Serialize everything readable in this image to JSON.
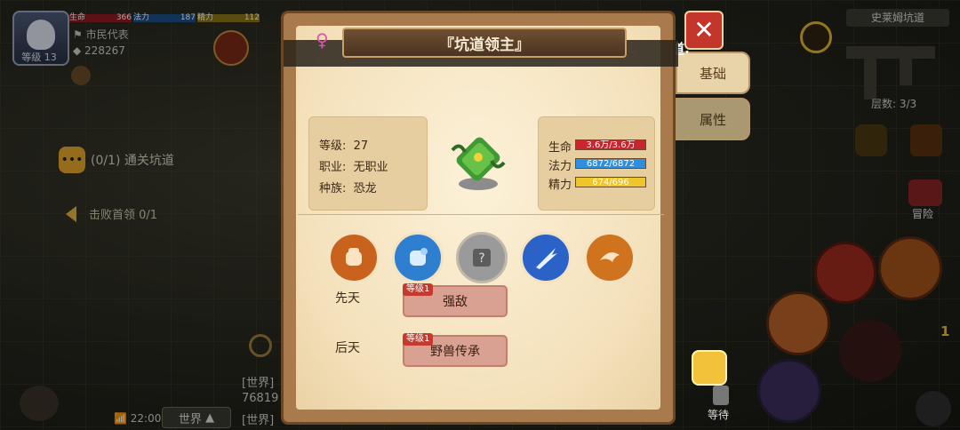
{
  "player": {
    "level_label": "等级 13",
    "hp_label": "生命",
    "hp_value": "366",
    "mp_label": "法力",
    "mp_value": "187",
    "sp_label": "精力",
    "sp_value": "112",
    "title": "市民代表",
    "gold": "228267"
  },
  "left_panel": {
    "quest_badge": "•••",
    "quest_text": "(0/1) 通关坑道",
    "boss_text": "击败首领 0/1"
  },
  "chat": {
    "line1": "[世界]",
    "line2": "76819",
    "line3": "[世界]",
    "time": "22:00",
    "channel": "世界"
  },
  "right_panel": {
    "map_title": "史莱姆坑道",
    "floor": "层数: 3/3",
    "adventure_label": "冒险",
    "wait_label": "等待",
    "skill_count": "1"
  },
  "side_tabs": {
    "overflow_text": "一道:",
    "basic": "基础",
    "attributes": "属性"
  },
  "close_label": "✕",
  "dialog": {
    "title": "『坑道领主』",
    "gender_icon": "♀",
    "info": {
      "level_label": "等级:",
      "level_value": "27",
      "job_label": "职业:",
      "job_value": "无职业",
      "race_label": "种族:",
      "race_value": "恐龙"
    },
    "stats": {
      "hp_label": "生命",
      "hp_value": "3.6万/3.6万",
      "mp_label": "法力",
      "mp_value": "6872/6872",
      "sp_label": "精力",
      "sp_value": "674/696"
    },
    "skills": [
      {
        "name": "fist-skill-icon",
        "color": "#c9621c"
      },
      {
        "name": "rock-fist-skill-icon",
        "color": "#2f7fd0"
      },
      {
        "name": "unknown-skill-icon",
        "color": "#9a9a9a"
      },
      {
        "name": "slash-skill-icon",
        "color": "#2a62c8"
      },
      {
        "name": "beast-leap-skill-icon",
        "color": "#d0731e"
      }
    ],
    "traits": {
      "innate_label": "先天",
      "innate_level": "等级1",
      "innate_value": "强敌",
      "acquired_label": "后天",
      "acquired_level": "等级1",
      "acquired_value": "野兽传承"
    }
  },
  "colors": {
    "hp_bar": "#c9252e",
    "mp_bar": "#2e8fe0",
    "sp_bar": "#f0c52c",
    "close_button": "#c4352b",
    "trait_button": "#d9a191"
  }
}
